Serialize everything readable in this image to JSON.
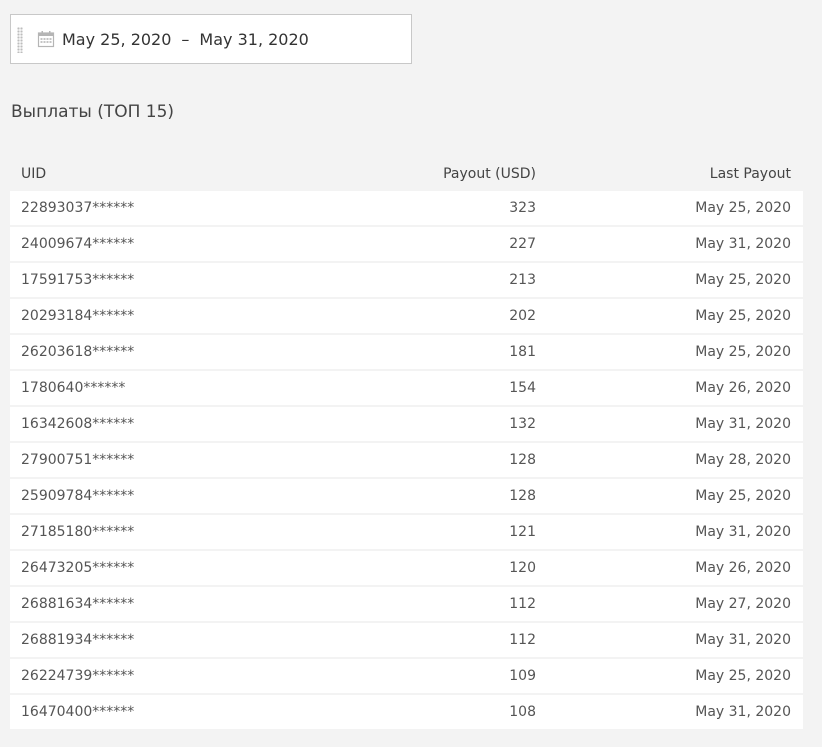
{
  "date_range": {
    "start": "May 25, 2020",
    "separator": "–",
    "end": "May 31, 2020",
    "icon": "calendar-icon"
  },
  "section_title": "Выплаты (ТОП 15)",
  "table": {
    "headers": {
      "uid": "UID",
      "payout": "Payout (USD)",
      "last_payout": "Last Payout"
    },
    "rows": [
      {
        "uid": "22893037******",
        "payout": "323",
        "last_payout": "May 25, 2020"
      },
      {
        "uid": "24009674******",
        "payout": "227",
        "last_payout": "May 31, 2020"
      },
      {
        "uid": "17591753******",
        "payout": "213",
        "last_payout": "May 25, 2020"
      },
      {
        "uid": "20293184******",
        "payout": "202",
        "last_payout": "May 25, 2020"
      },
      {
        "uid": "26203618******",
        "payout": "181",
        "last_payout": "May 25, 2020"
      },
      {
        "uid": "1780640******",
        "payout": "154",
        "last_payout": "May 26, 2020"
      },
      {
        "uid": "16342608******",
        "payout": "132",
        "last_payout": "May 31, 2020"
      },
      {
        "uid": "27900751******",
        "payout": "128",
        "last_payout": "May 28, 2020"
      },
      {
        "uid": "25909784******",
        "payout": "128",
        "last_payout": "May 25, 2020"
      },
      {
        "uid": "27185180******",
        "payout": "121",
        "last_payout": "May 31, 2020"
      },
      {
        "uid": "26473205******",
        "payout": "120",
        "last_payout": "May 26, 2020"
      },
      {
        "uid": "26881634******",
        "payout": "112",
        "last_payout": "May 27, 2020"
      },
      {
        "uid": "26881934******",
        "payout": "112",
        "last_payout": "May 31, 2020"
      },
      {
        "uid": "26224739******",
        "payout": "109",
        "last_payout": "May 25, 2020"
      },
      {
        "uid": "16470400******",
        "payout": "108",
        "last_payout": "May 31, 2020"
      }
    ]
  }
}
